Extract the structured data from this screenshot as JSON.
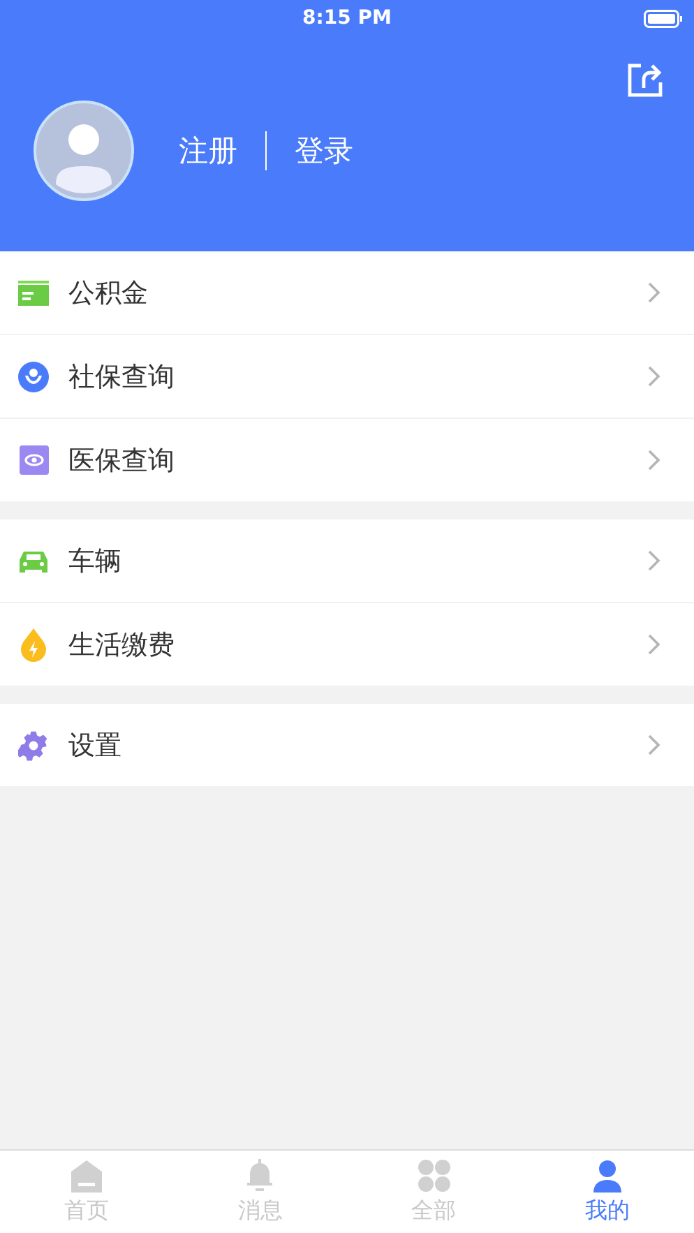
{
  "status_bar": {
    "time": "8:15 PM"
  },
  "header": {
    "register": "注册",
    "login": "登录"
  },
  "groups": [
    {
      "items": [
        {
          "label": "公积金",
          "kind": "card"
        },
        {
          "label": "社保查询",
          "kind": "shield"
        },
        {
          "label": "医保查询",
          "kind": "eye"
        }
      ]
    },
    {
      "items": [
        {
          "label": "车辆",
          "kind": "car"
        },
        {
          "label": "生活缴费",
          "kind": "drop"
        }
      ]
    },
    {
      "items": [
        {
          "label": "设置",
          "kind": "gear"
        }
      ]
    }
  ],
  "tab_bar": [
    {
      "label": "首页",
      "kind": "home",
      "selected": false
    },
    {
      "label": "消息",
      "kind": "bell",
      "selected": false
    },
    {
      "label": "全部",
      "kind": "grid",
      "selected": false
    },
    {
      "label": "我的",
      "kind": "person",
      "selected": true
    }
  ]
}
